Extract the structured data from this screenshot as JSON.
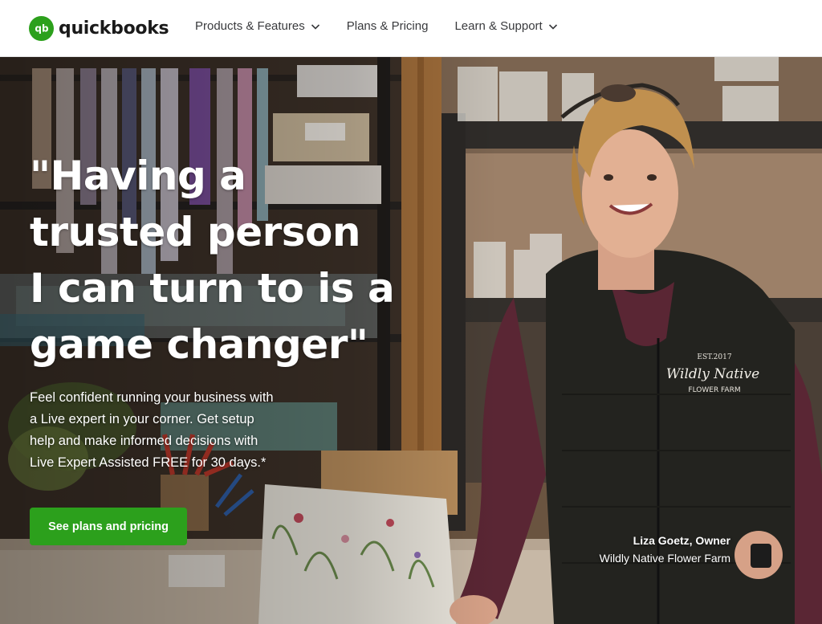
{
  "brand": {
    "name": "quickbooks",
    "mark": "qb",
    "color": "#2ca01c"
  },
  "nav": {
    "items": [
      {
        "label": "Products & Features",
        "has_dropdown": true
      },
      {
        "label": "Plans & Pricing",
        "has_dropdown": false
      },
      {
        "label": "Learn & Support",
        "has_dropdown": true
      }
    ]
  },
  "hero": {
    "headline_lines": [
      "\"Having a",
      "trusted person",
      "I can turn to is a",
      "game changer\""
    ],
    "subtext_lines": [
      "Feel confident running your business with",
      "a Live expert in your corner. Get setup",
      "help and make informed decisions with",
      "Live Expert Assisted FREE for 30 days.*"
    ],
    "cta_label": "See plans and pricing",
    "caption_name": "Liza Goetz, Owner",
    "caption_company": "Wildly Native Flower Farm",
    "vest_logo": {
      "line1": "EST.2017",
      "line2": "Wildly Native",
      "line3": "FLOWER FARM"
    }
  }
}
